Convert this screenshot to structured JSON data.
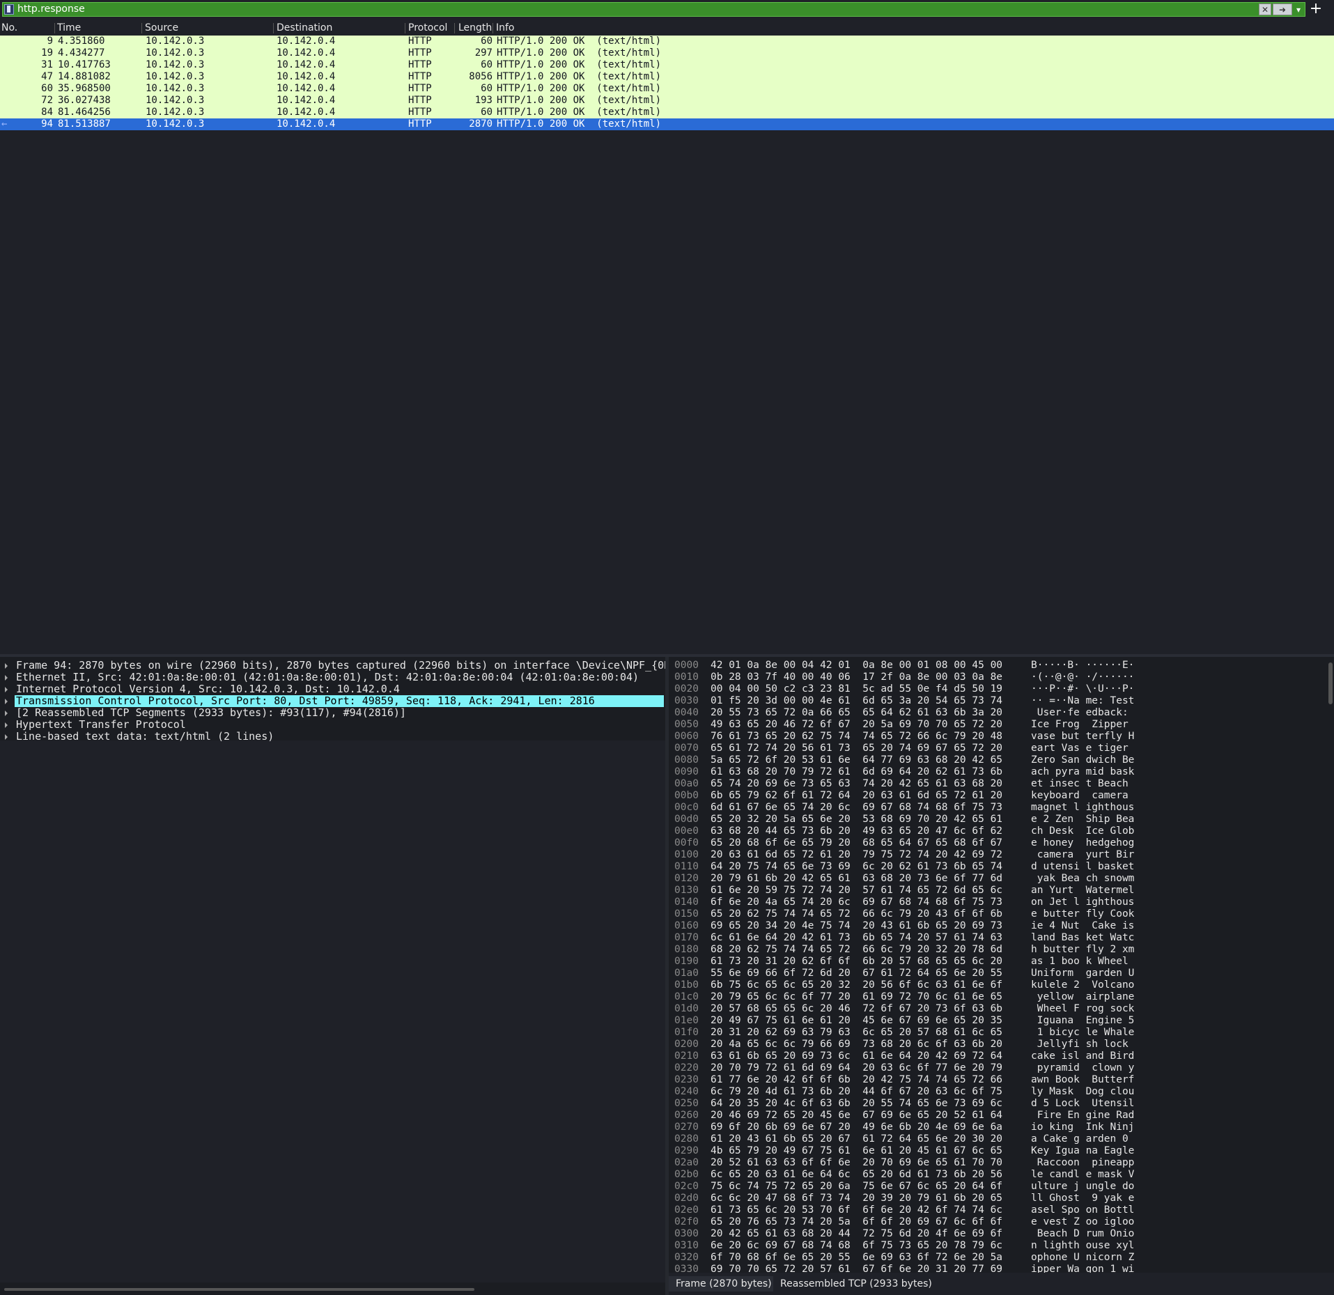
{
  "filter": {
    "value": "http.response"
  },
  "packet_list": {
    "columns": [
      "No.",
      "Time",
      "Source",
      "Destination",
      "Protocol",
      "Length",
      "Info"
    ],
    "rows": [
      {
        "no": "9",
        "time": "4.351860",
        "src": "10.142.0.3",
        "dst": "10.142.0.4",
        "proto": "HTTP",
        "len": "60",
        "info": "HTTP/1.0 200 OK  (text/html)"
      },
      {
        "no": "19",
        "time": "4.434277",
        "src": "10.142.0.3",
        "dst": "10.142.0.4",
        "proto": "HTTP",
        "len": "297",
        "info": "HTTP/1.0 200 OK  (text/html)"
      },
      {
        "no": "31",
        "time": "10.417763",
        "src": "10.142.0.3",
        "dst": "10.142.0.4",
        "proto": "HTTP",
        "len": "60",
        "info": "HTTP/1.0 200 OK  (text/html)"
      },
      {
        "no": "47",
        "time": "14.881082",
        "src": "10.142.0.3",
        "dst": "10.142.0.4",
        "proto": "HTTP",
        "len": "8056",
        "info": "HTTP/1.0 200 OK  (text/html)"
      },
      {
        "no": "60",
        "time": "35.968500",
        "src": "10.142.0.3",
        "dst": "10.142.0.4",
        "proto": "HTTP",
        "len": "60",
        "info": "HTTP/1.0 200 OK  (text/html)"
      },
      {
        "no": "72",
        "time": "36.027438",
        "src": "10.142.0.3",
        "dst": "10.142.0.4",
        "proto": "HTTP",
        "len": "193",
        "info": "HTTP/1.0 200 OK  (text/html)"
      },
      {
        "no": "84",
        "time": "81.464256",
        "src": "10.142.0.3",
        "dst": "10.142.0.4",
        "proto": "HTTP",
        "len": "60",
        "info": "HTTP/1.0 200 OK  (text/html)"
      },
      {
        "no": "94",
        "time": "81.513887",
        "src": "10.142.0.3",
        "dst": "10.142.0.4",
        "proto": "HTTP",
        "len": "2870",
        "info": "HTTP/1.0 200 OK  (text/html)"
      }
    ],
    "selected_marker": "←"
  },
  "details": [
    "Frame 94: 2870 bytes on wire (22960 bits), 2870 bytes captured (22960 bits) on interface \\Device\\NPF_{0B",
    "Ethernet II, Src: 42:01:0a:8e:00:01 (42:01:0a:8e:00:01), Dst: 42:01:0a:8e:00:04 (42:01:0a:8e:00:04)",
    "Internet Protocol Version 4, Src: 10.142.0.3, Dst: 10.142.0.4",
    "Transmission Control Protocol, Src Port: 80, Dst Port: 49859, Seq: 118, Ack: 2941, Len: 2816",
    "[2 Reassembled TCP Segments (2933 bytes): #93(117), #94(2816)]",
    "Hypertext Transfer Protocol",
    "Line-based text data: text/html (2 lines)"
  ],
  "bytes": [
    {
      "o": "0000",
      "h": "42 01 0a 8e 00 04 42 01  0a 8e 00 01 08 00 45 00",
      "a": "B·····B· ······E·"
    },
    {
      "o": "0010",
      "h": "0b 28 03 7f 40 00 40 06  17 2f 0a 8e 00 03 0a 8e",
      "a": "·(··@·@· ·/······"
    },
    {
      "o": "0020",
      "h": "00 04 00 50 c2 c3 23 81  5c ad 55 0e f4 d5 50 19",
      "a": "···P··#· \\·U···P·"
    },
    {
      "o": "0030",
      "h": "01 f5 20 3d 00 00 4e 61  6d 65 3a 20 54 65 73 74",
      "a": "·· =··Na me: Test"
    },
    {
      "o": "0040",
      "h": "20 55 73 65 72 0a 66 65  65 64 62 61 63 6b 3a 20",
      "a": " User·fe edback: "
    },
    {
      "o": "0050",
      "h": "49 63 65 20 46 72 6f 67  20 5a 69 70 70 65 72 20",
      "a": "Ice Frog  Zipper "
    },
    {
      "o": "0060",
      "h": "76 61 73 65 20 62 75 74  74 65 72 66 6c 79 20 48",
      "a": "vase but terfly H"
    },
    {
      "o": "0070",
      "h": "65 61 72 74 20 56 61 73  65 20 74 69 67 65 72 20",
      "a": "eart Vas e tiger "
    },
    {
      "o": "0080",
      "h": "5a 65 72 6f 20 53 61 6e  64 77 69 63 68 20 42 65",
      "a": "Zero San dwich Be"
    },
    {
      "o": "0090",
      "h": "61 63 68 20 70 79 72 61  6d 69 64 20 62 61 73 6b",
      "a": "ach pyra mid bask"
    },
    {
      "o": "00a0",
      "h": "65 74 20 69 6e 73 65 63  74 20 42 65 61 63 68 20",
      "a": "et insec t Beach "
    },
    {
      "o": "00b0",
      "h": "6b 65 79 62 6f 61 72 64  20 63 61 6d 65 72 61 20",
      "a": "keyboard  camera "
    },
    {
      "o": "00c0",
      "h": "6d 61 67 6e 65 74 20 6c  69 67 68 74 68 6f 75 73",
      "a": "magnet l ighthous"
    },
    {
      "o": "00d0",
      "h": "65 20 32 20 5a 65 6e 20  53 68 69 70 20 42 65 61",
      "a": "e 2 Zen  Ship Bea"
    },
    {
      "o": "00e0",
      "h": "63 68 20 44 65 73 6b 20  49 63 65 20 47 6c 6f 62",
      "a": "ch Desk  Ice Glob"
    },
    {
      "o": "00f0",
      "h": "65 20 68 6f 6e 65 79 20  68 65 64 67 65 68 6f 67",
      "a": "e honey  hedgehog"
    },
    {
      "o": "0100",
      "h": "20 63 61 6d 65 72 61 20  79 75 72 74 20 42 69 72",
      "a": " camera  yurt Bir"
    },
    {
      "o": "0110",
      "h": "64 20 75 74 65 6e 73 69  6c 20 62 61 73 6b 65 74",
      "a": "d utensi l basket"
    },
    {
      "o": "0120",
      "h": "20 79 61 6b 20 42 65 61  63 68 20 73 6e 6f 77 6d",
      "a": " yak Bea ch snowm"
    },
    {
      "o": "0130",
      "h": "61 6e 20 59 75 72 74 20  57 61 74 65 72 6d 65 6c",
      "a": "an Yurt  Watermel"
    },
    {
      "o": "0140",
      "h": "6f 6e 20 4a 65 74 20 6c  69 67 68 74 68 6f 75 73",
      "a": "on Jet l ighthous"
    },
    {
      "o": "0150",
      "h": "65 20 62 75 74 74 65 72  66 6c 79 20 43 6f 6f 6b",
      "a": "e butter fly Cook"
    },
    {
      "o": "0160",
      "h": "69 65 20 34 20 4e 75 74  20 43 61 6b 65 20 69 73",
      "a": "ie 4 Nut  Cake is"
    },
    {
      "o": "0170",
      "h": "6c 61 6e 64 20 42 61 73  6b 65 74 20 57 61 74 63",
      "a": "land Bas ket Watc"
    },
    {
      "o": "0180",
      "h": "68 20 62 75 74 74 65 72  66 6c 79 20 32 20 78 6d",
      "a": "h butter fly 2 xm"
    },
    {
      "o": "0190",
      "h": "61 73 20 31 20 62 6f 6f  6b 20 57 68 65 65 6c 20",
      "a": "as 1 boo k Wheel "
    },
    {
      "o": "01a0",
      "h": "55 6e 69 66 6f 72 6d 20  67 61 72 64 65 6e 20 55",
      "a": "Uniform  garden U"
    },
    {
      "o": "01b0",
      "h": "6b 75 6c 65 6c 65 20 32  20 56 6f 6c 63 61 6e 6f",
      "a": "kulele 2  Volcano"
    },
    {
      "o": "01c0",
      "h": "20 79 65 6c 6c 6f 77 20  61 69 72 70 6c 61 6e 65",
      "a": " yellow  airplane"
    },
    {
      "o": "01d0",
      "h": "20 57 68 65 65 6c 20 46  72 6f 67 20 73 6f 63 6b",
      "a": " Wheel F rog sock"
    },
    {
      "o": "01e0",
      "h": "20 49 67 75 61 6e 61 20  45 6e 67 69 6e 65 20 35",
      "a": " Iguana  Engine 5"
    },
    {
      "o": "01f0",
      "h": "20 31 20 62 69 63 79 63  6c 65 20 57 68 61 6c 65",
      "a": " 1 bicyc le Whale"
    },
    {
      "o": "0200",
      "h": "20 4a 65 6c 6c 79 66 69  73 68 20 6c 6f 63 6b 20",
      "a": " Jellyfi sh lock "
    },
    {
      "o": "0210",
      "h": "63 61 6b 65 20 69 73 6c  61 6e 64 20 42 69 72 64",
      "a": "cake isl and Bird"
    },
    {
      "o": "0220",
      "h": "20 70 79 72 61 6d 69 64  20 63 6c 6f 77 6e 20 79",
      "a": " pyramid  clown y"
    },
    {
      "o": "0230",
      "h": "61 77 6e 20 42 6f 6f 6b  20 42 75 74 74 65 72 66",
      "a": "awn Book  Butterf"
    },
    {
      "o": "0240",
      "h": "6c 79 20 4d 61 73 6b 20  44 6f 67 20 63 6c 6f 75",
      "a": "ly Mask  Dog clou"
    },
    {
      "o": "0250",
      "h": "64 20 35 20 4c 6f 63 6b  20 55 74 65 6e 73 69 6c",
      "a": "d 5 Lock  Utensil"
    },
    {
      "o": "0260",
      "h": "20 46 69 72 65 20 45 6e  67 69 6e 65 20 52 61 64",
      "a": " Fire En gine Rad"
    },
    {
      "o": "0270",
      "h": "69 6f 20 6b 69 6e 67 20  49 6e 6b 20 4e 69 6e 6a",
      "a": "io king  Ink Ninj"
    },
    {
      "o": "0280",
      "h": "61 20 43 61 6b 65 20 67  61 72 64 65 6e 20 30 20",
      "a": "a Cake g arden 0 "
    },
    {
      "o": "0290",
      "h": "4b 65 79 20 49 67 75 61  6e 61 20 45 61 67 6c 65",
      "a": "Key Igua na Eagle"
    },
    {
      "o": "02a0",
      "h": "20 52 61 63 63 6f 6f 6e  20 70 69 6e 65 61 70 70",
      "a": " Raccoon  pineapp"
    },
    {
      "o": "02b0",
      "h": "6c 65 20 63 61 6e 64 6c  65 20 6d 61 73 6b 20 56",
      "a": "le candl e mask V"
    },
    {
      "o": "02c0",
      "h": "75 6c 74 75 72 65 20 6a  75 6e 67 6c 65 20 64 6f",
      "a": "ulture j ungle do"
    },
    {
      "o": "02d0",
      "h": "6c 6c 20 47 68 6f 73 74  20 39 20 79 61 6b 20 65",
      "a": "ll Ghost  9 yak e"
    },
    {
      "o": "02e0",
      "h": "61 73 65 6c 20 53 70 6f  6f 6e 20 42 6f 74 74 6c",
      "a": "asel Spo on Bottl"
    },
    {
      "o": "02f0",
      "h": "65 20 76 65 73 74 20 5a  6f 6f 20 69 67 6c 6f 6f",
      "a": "e vest Z oo igloo"
    },
    {
      "o": "0300",
      "h": "20 42 65 61 63 68 20 44  72 75 6d 20 4f 6e 69 6f",
      "a": " Beach D rum Onio"
    },
    {
      "o": "0310",
      "h": "6e 20 6c 69 67 68 74 68  6f 75 73 65 20 78 79 6c",
      "a": "n lighth ouse xyl"
    },
    {
      "o": "0320",
      "h": "6f 70 68 6f 6e 65 20 55  6e 69 63 6f 72 6e 20 5a",
      "a": "ophone U nicorn Z"
    },
    {
      "o": "0330",
      "h": "69 70 70 65 72 20 57 61  67 6f 6e 20 31 20 77 69",
      "a": "ipper Wa gon 1 wi"
    }
  ],
  "tabs": {
    "frame": "Frame (2870 bytes)",
    "reassembled": "Reassembled TCP (2933 bytes)"
  }
}
